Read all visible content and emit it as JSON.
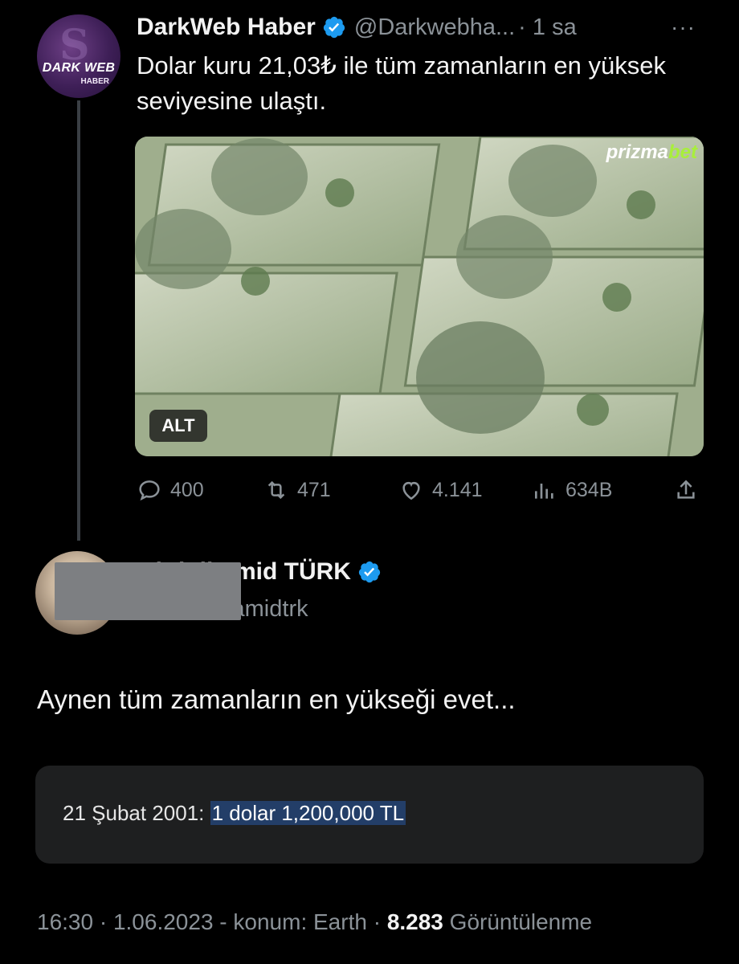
{
  "tweet": {
    "avatar_text_1": "DARK WEB",
    "avatar_text_2": "HABER",
    "name": "DarkWeb Haber",
    "handle": "@Darkwebha...",
    "time": "· 1 sa",
    "more_label": "···",
    "text": "Dolar kuru 21,03₺ ile tüm zamanların en yüksek seviyesine ulaştı.",
    "media": {
      "alt_badge": "ALT",
      "watermark_part1": "prizma",
      "watermark_part2": "bet"
    },
    "actions": [
      {
        "icon": "reply-icon",
        "value": "400"
      },
      {
        "icon": "retweet-icon",
        "value": "471"
      },
      {
        "icon": "like-icon",
        "value": "4.141"
      },
      {
        "icon": "views-icon",
        "value": "634B"
      },
      {
        "icon": "share-icon",
        "value": ""
      }
    ]
  },
  "reply": {
    "name": "Abdülhamid TÜRK",
    "handle": "@abdulhamidtrk",
    "text": "Aynen tüm zamanların en yükseği evet...",
    "quote_prefix": "21 Şubat 2001: ",
    "quote_highlight": "1 dolar 1,200,000 TL",
    "meta_prefix": "16:30 · 1.06.2023 - konum: Earth · ",
    "views_count": "8.283",
    "views_label": " Görüntülenme"
  },
  "colors": {
    "background": "#000000",
    "muted": "#8b9298",
    "verified": "#1d9bf0",
    "thread_line": "#3a3f44",
    "quote_bg": "#1e1f20",
    "highlight": "#233e68"
  }
}
